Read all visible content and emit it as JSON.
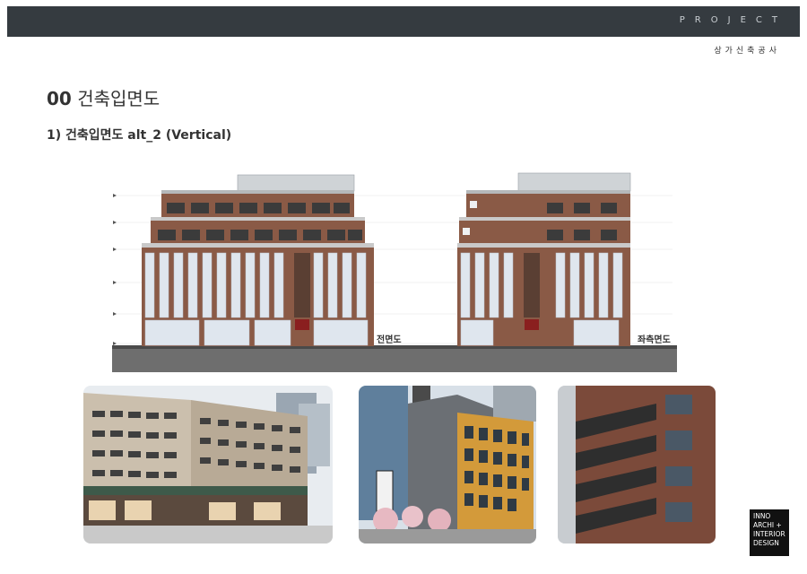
{
  "header": {
    "project_label": "PROJECT",
    "subtitle": "상가신축공사"
  },
  "page": {
    "number": "00",
    "title": "건축입면도",
    "section_title": "1) 건축입면도 alt_2 (Vertical)"
  },
  "elevations": {
    "front_label": "전면도",
    "left_label": "좌측면도"
  },
  "logo": {
    "lines": [
      "INNO",
      "ARCHI +",
      "INTERIOR",
      "DESIGN"
    ]
  },
  "colors": {
    "topbar": "#353b40",
    "brick": "#8a5a46",
    "glass": "#dfe6ee",
    "ground": "#6e6e6e",
    "accent_orange": "#d39a3a"
  }
}
